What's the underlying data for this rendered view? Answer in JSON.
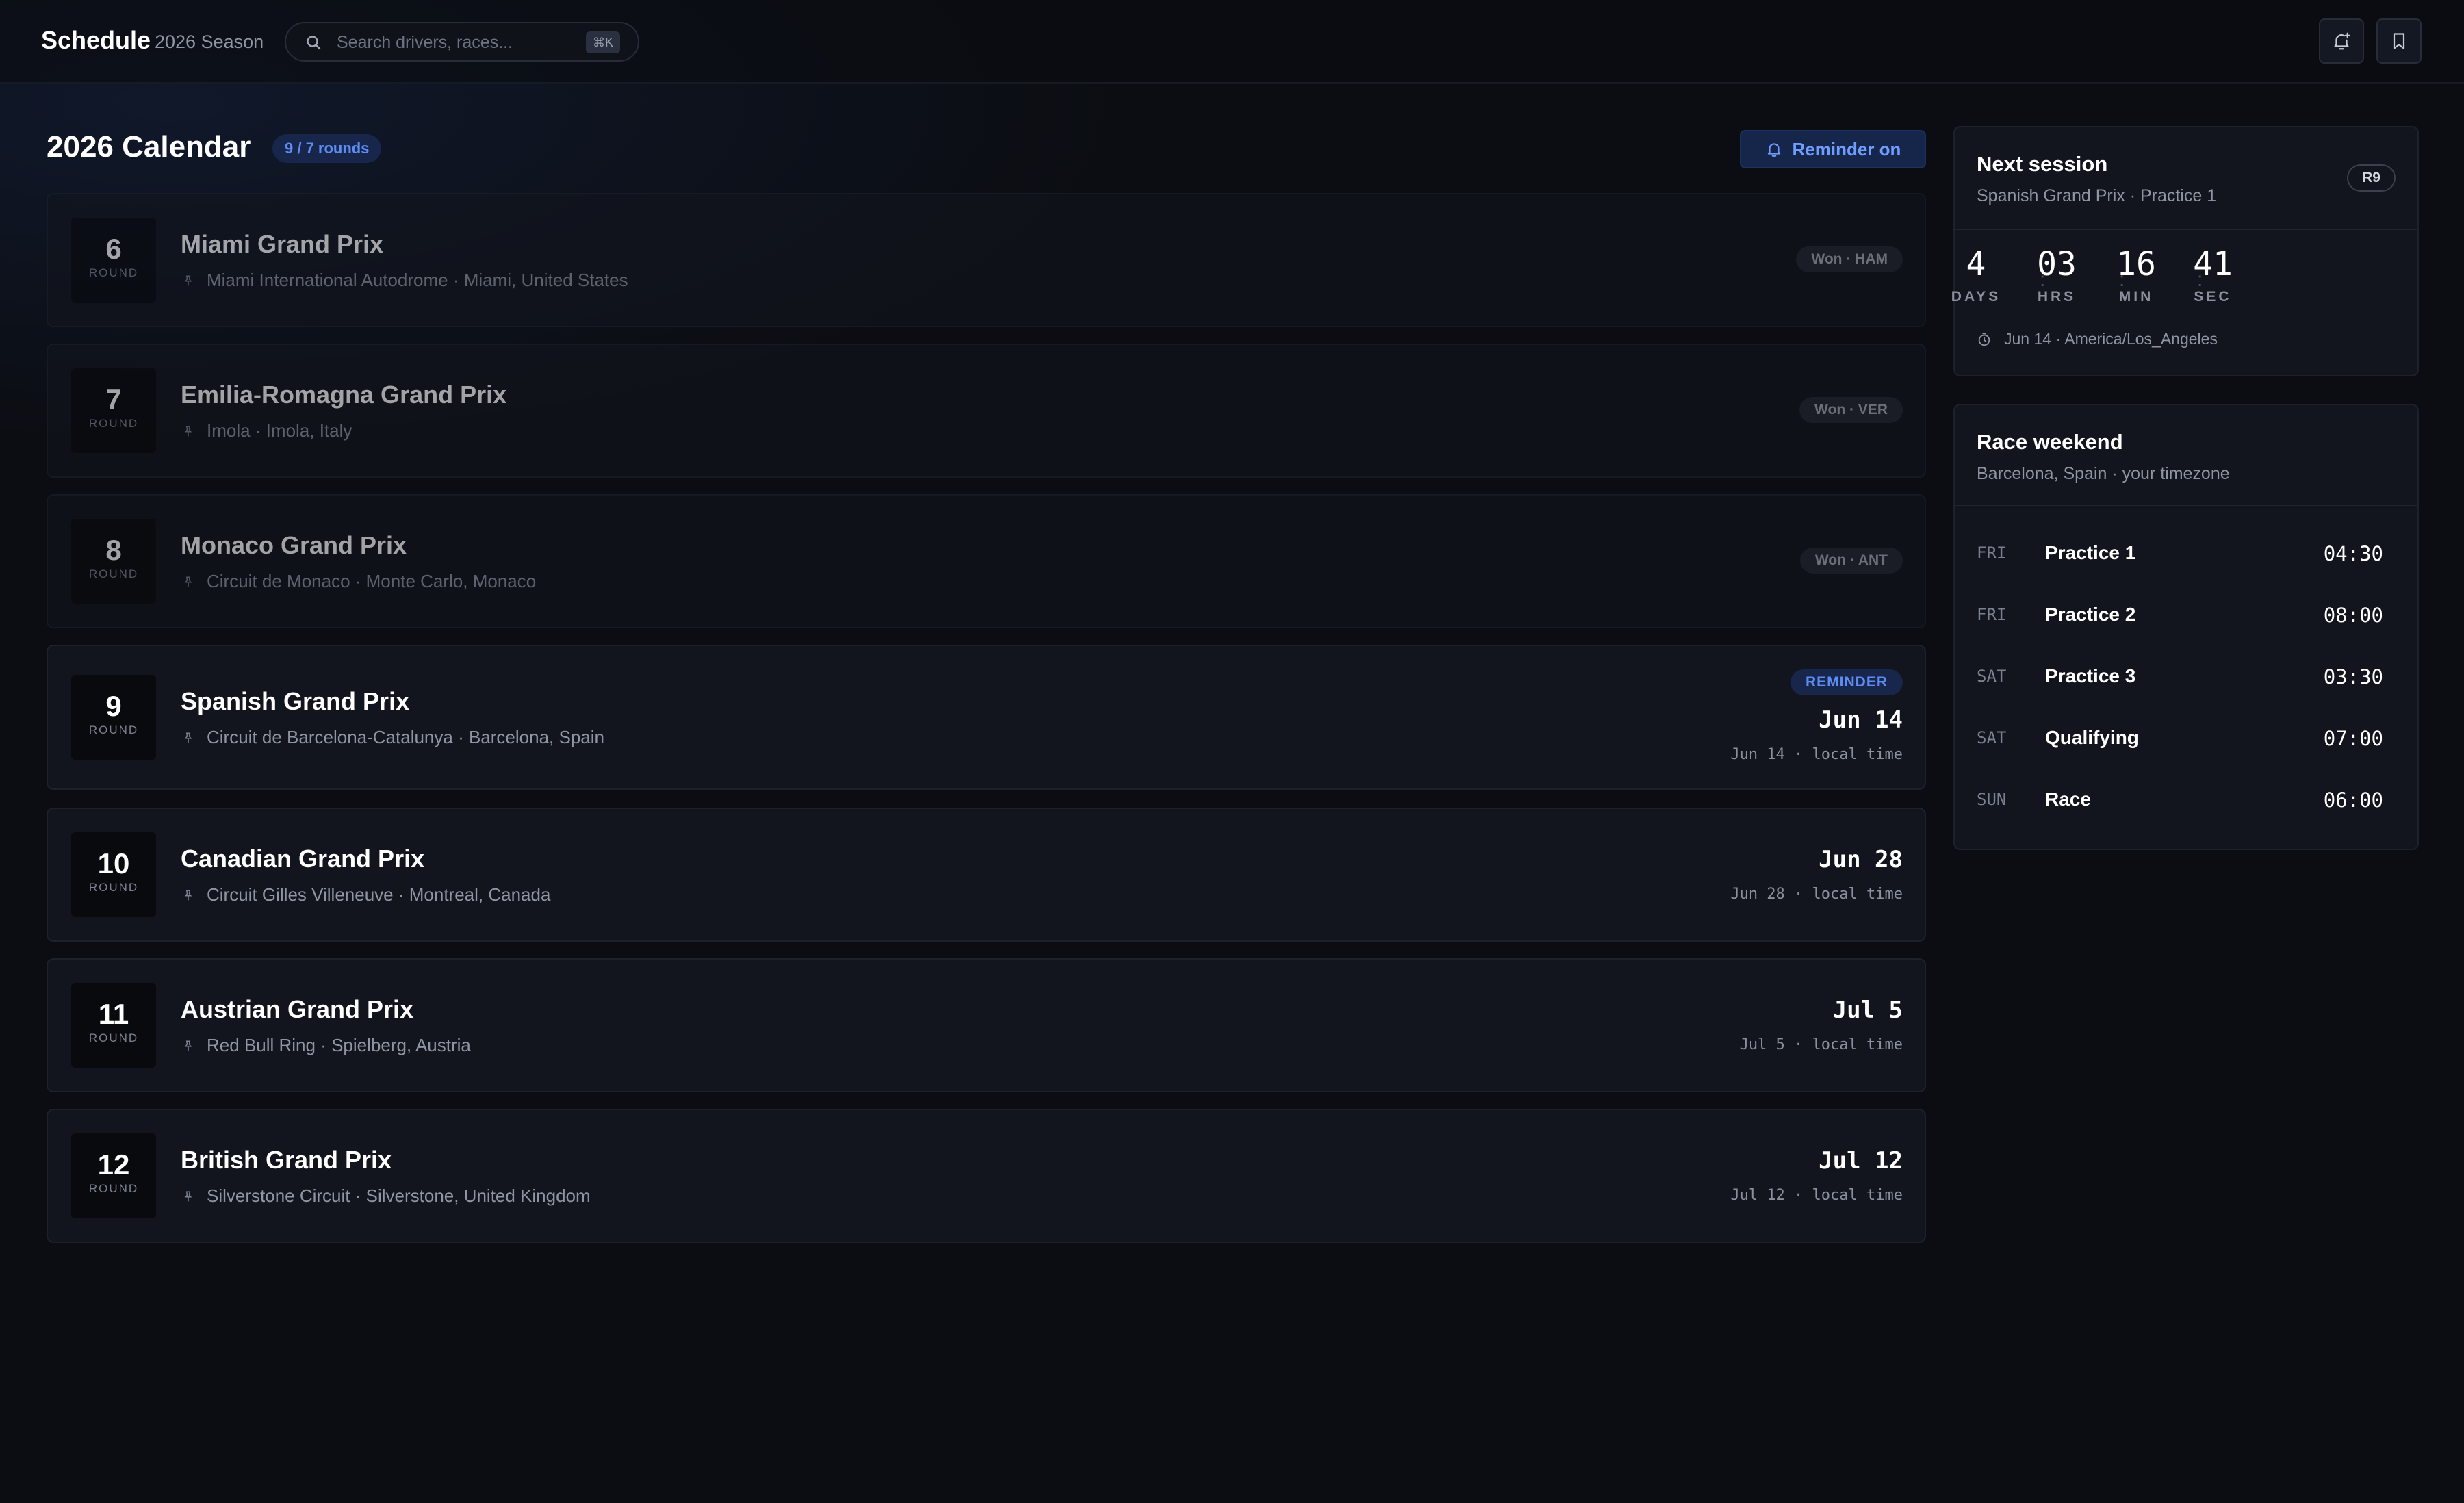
{
  "header": {
    "title": "Schedule",
    "season": "2026 Season",
    "search_placeholder": "Search drivers, races...",
    "search_shortcut": "⌘K",
    "icons": [
      "bell-plus-icon",
      "bookmark-icon"
    ]
  },
  "calendar": {
    "title": "2026 Calendar",
    "rounds_badge": "9 / 7 rounds",
    "reminder_button": "Reminder on",
    "round_label": "ROUND",
    "races": [
      {
        "round": "6",
        "name": "Miami Grand Prix",
        "venue": "Miami International Autodrome · Miami, United States",
        "status": "Won · HAM"
      },
      {
        "round": "7",
        "name": "Emilia-Romagna Grand Prix",
        "venue": "Imola · Imola, Italy",
        "status": "Won · VER"
      },
      {
        "round": "8",
        "name": "Monaco Grand Prix",
        "venue": "Circuit de Monaco · Monte Carlo, Monaco",
        "status": "Won · ANT"
      },
      {
        "round": "9",
        "name": "Spanish Grand Prix",
        "venue": "Circuit de Barcelona-Catalunya · Barcelona, Spain",
        "badge": "REMINDER",
        "date": "Jun 14",
        "local": "Jun 14 · local time"
      },
      {
        "round": "10",
        "name": "Canadian Grand Prix",
        "venue": "Circuit Gilles Villeneuve · Montreal, Canada",
        "date": "Jun 28",
        "local": "Jun 28 · local time"
      },
      {
        "round": "11",
        "name": "Austrian Grand Prix",
        "venue": "Red Bull Ring · Spielberg, Austria",
        "date": "Jul 5",
        "local": "Jul 5 · local time"
      },
      {
        "round": "12",
        "name": "British Grand Prix",
        "venue": "Silverstone Circuit · Silverstone, United Kingdom",
        "date": "Jul 12",
        "local": "Jul 12 · local time"
      }
    ]
  },
  "next_session": {
    "title": "Next session",
    "subtitle": "Spanish Grand Prix · Practice 1",
    "round_badge": "R9",
    "countdown": [
      {
        "value": "4",
        "label": "DAYS"
      },
      {
        "value": "03",
        "label": "HRS"
      },
      {
        "value": "16",
        "label": "MIN"
      },
      {
        "value": "41",
        "label": "SEC"
      }
    ],
    "separator": ":",
    "timezone": "Jun 14 · America/Los_Angeles"
  },
  "race_weekend": {
    "title": "Race weekend",
    "subtitle": "Barcelona, Spain · your timezone",
    "sessions": [
      {
        "day": "FRI",
        "name": "Practice 1",
        "time": "04:30"
      },
      {
        "day": "FRI",
        "name": "Practice 2",
        "time": "08:00"
      },
      {
        "day": "SAT",
        "name": "Practice 3",
        "time": "03:30"
      },
      {
        "day": "SAT",
        "name": "Qualifying",
        "time": "07:00"
      },
      {
        "day": "SUN",
        "name": "Race",
        "time": "06:00"
      }
    ]
  },
  "colors": {
    "background": "#0b0d12",
    "card": "#12151d",
    "accent": "#5d8cf2",
    "text": "#ffffff",
    "muted": "#8f95a3"
  }
}
